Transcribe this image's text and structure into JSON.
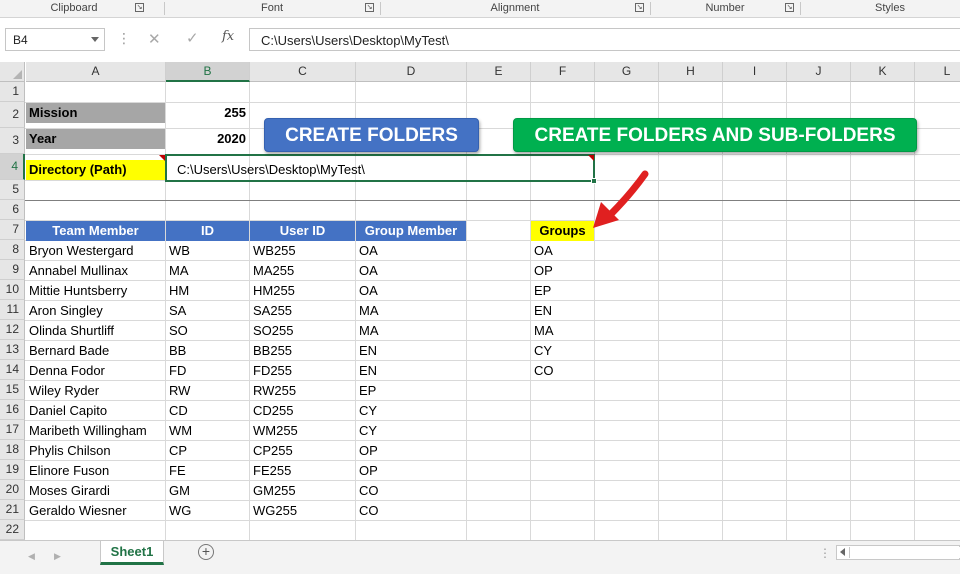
{
  "ribbon": {
    "groups": [
      {
        "label": "Clipboard",
        "launcher": true
      },
      {
        "label": "Font",
        "launcher": true
      },
      {
        "label": "Alignment",
        "launcher": true
      },
      {
        "label": "Number",
        "launcher": true
      },
      {
        "label": "Styles",
        "launcher": false
      }
    ]
  },
  "formula_bar": {
    "name_box": "B4",
    "formula": "C:\\Users\\Users\\Desktop\\MyTest\\",
    "cancel_icon": "close-icon",
    "enter_icon": "check-icon",
    "fx_label": "fx"
  },
  "columns": [
    "A",
    "B",
    "C",
    "D",
    "E",
    "F",
    "G",
    "H",
    "I",
    "J",
    "K",
    "L"
  ],
  "rows": [
    "1",
    "2",
    "3",
    "4",
    "5",
    "6",
    "7",
    "8",
    "9",
    "10",
    "11",
    "12",
    "13",
    "14",
    "15",
    "16",
    "17",
    "18",
    "19",
    "20",
    "21",
    "22"
  ],
  "selected_cell": {
    "column": "B",
    "row": "4"
  },
  "params": {
    "mission_label": "Mission",
    "mission_value": "255",
    "year_label": "Year",
    "year_value": "2020",
    "directory_label": "Directory (Path)",
    "directory_value": "C:\\Users\\Users\\Desktop\\MyTest\\"
  },
  "buttons": {
    "create_folders": "CREATE FOLDERS",
    "create_subfolders": "CREATE FOLDERS AND SUB-FOLDERS"
  },
  "table": {
    "headers": [
      "Team Member",
      "ID",
      "User ID",
      "Group Member"
    ],
    "rows": [
      [
        "Bryon Westergard",
        "WB",
        "WB255",
        "OA"
      ],
      [
        "Annabel Mullinax",
        "MA",
        "MA255",
        "OA"
      ],
      [
        "Mittie Huntsberry",
        "HM",
        "HM255",
        "OA"
      ],
      [
        "Aron Singley",
        "SA",
        "SA255",
        "MA"
      ],
      [
        "Olinda Shurtliff",
        "SO",
        "SO255",
        "MA"
      ],
      [
        "Bernard Bade",
        "BB",
        "BB255",
        "EN"
      ],
      [
        "Denna Fodor",
        "FD",
        "FD255",
        "EN"
      ],
      [
        "Wiley Ryder",
        "RW",
        "RW255",
        "EP"
      ],
      [
        "Daniel Capito",
        "CD",
        "CD255",
        "CY"
      ],
      [
        "Maribeth Willingham",
        "WM",
        "WM255",
        "CY"
      ],
      [
        "Phylis Chilson",
        "CP",
        "CP255",
        "OP"
      ],
      [
        "Elinore Fuson",
        "FE",
        "FE255",
        "OP"
      ],
      [
        "Moses Girardi",
        "GM",
        "GM255",
        "CO"
      ],
      [
        "Geraldo Wiesner",
        "WG",
        "WG255",
        "CO"
      ]
    ]
  },
  "groups": {
    "header": "Groups",
    "items": [
      "OA",
      "OP",
      "EP",
      "EN",
      "MA",
      "CY",
      "CO"
    ]
  },
  "sheet_tabs": {
    "active": "Sheet1",
    "add_icon": "plus-circle-icon"
  },
  "colors": {
    "accent": "#217346",
    "table_header": "#4472c4",
    "highlight": "#ffff00",
    "label_gray": "#a6a6a6",
    "button_green": "#00b050",
    "arrow": "#e02020"
  }
}
